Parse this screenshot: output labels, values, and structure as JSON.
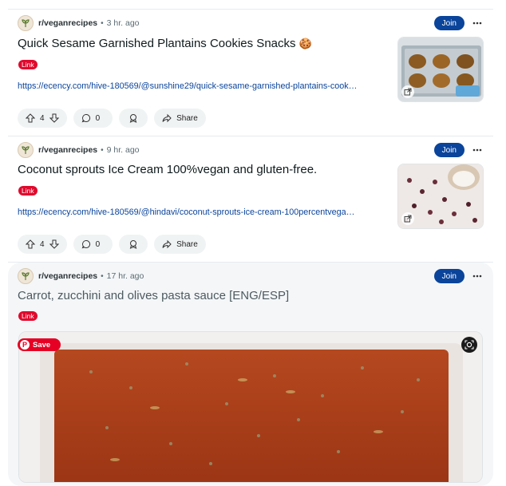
{
  "posts": [
    {
      "subreddit": "r/veganrecipes",
      "time": "3 hr. ago",
      "join_label": "Join",
      "title": "Quick Sesame Garnished Plantains Cookies Snacks",
      "title_emoji": "🍪",
      "tag": "Link",
      "url": "https://ecency.com/hive-180569/@sunshine29/quick-sesame-garnished-plantains-cook…",
      "upvotes": "4",
      "comments": "0",
      "share_label": "Share"
    },
    {
      "subreddit": "r/veganrecipes",
      "time": "9 hr. ago",
      "join_label": "Join",
      "title": "Coconut sprouts Ice Cream 100%vegan and gluten-free.",
      "tag": "Link",
      "url": "https://ecency.com/hive-180569/@hindavi/coconut-sprouts-ice-cream-100percentvega…",
      "upvotes": "4",
      "comments": "0",
      "share_label": "Share"
    },
    {
      "subreddit": "r/veganrecipes",
      "time": "17 hr. ago",
      "join_label": "Join",
      "title": "Carrot, zucchini and olives pasta sauce [ENG/ESP]",
      "tag": "Link",
      "save_label": "Save"
    }
  ],
  "colors": {
    "join_bg": "#0a449b",
    "link_tag": "#e00a2d",
    "url": "#0a449b",
    "pinterest": "#e60023"
  },
  "icons": [
    "upvote-icon",
    "downvote-icon",
    "comment-icon",
    "award-icon",
    "share-icon",
    "more-icon",
    "external-link-icon",
    "lens-icon",
    "pinterest-icon"
  ]
}
